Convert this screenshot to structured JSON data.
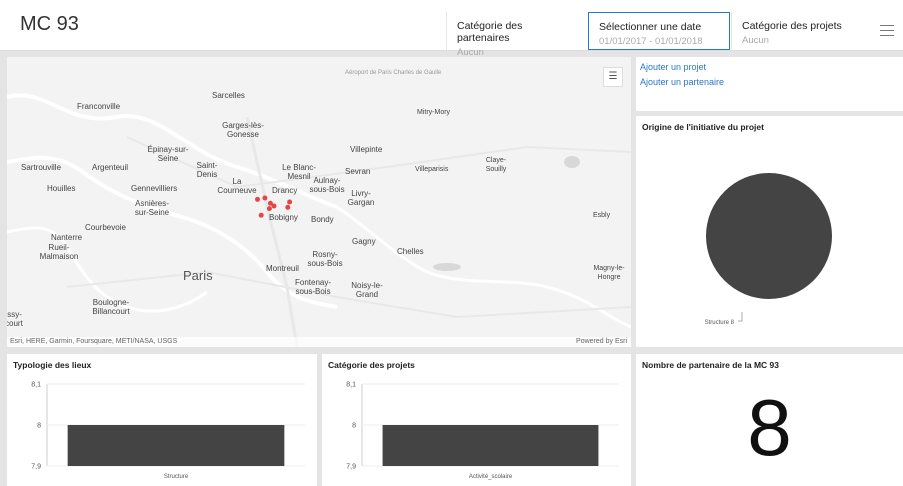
{
  "header": {
    "title": "MC 93",
    "filters": [
      {
        "label": "Catégorie des partenaires",
        "value": "Aucun"
      },
      {
        "label": "Sélectionner une date",
        "value": "01/01/2017 - 01/01/2018"
      },
      {
        "label": "Catégorie des projets",
        "value": "Aucun"
      }
    ]
  },
  "map": {
    "attribution": "Esri, HERE, Garmin, Foursquare, METI/NASA, USGS",
    "powered_by": "Powered by Esri",
    "legend_icon": "list-icon",
    "labels": [
      "Sarcelles",
      "Franconville",
      "Garges-lès-Gonesse",
      "Mitry-Mory",
      "Villepinte",
      "Épinay-sur-Seine",
      "Sartrouville",
      "Argenteuil",
      "Saint-Denis",
      "Le Blanc-Mesnil",
      "Sevran",
      "Villeparisis",
      "Claye-Souilly",
      "Houilles",
      "La Courneuve",
      "Drancy",
      "Aulnay-sous-Bois",
      "Gennevilliers",
      "Livry-Gargan",
      "Asnières-sur-Seine",
      "Bobigny",
      "Bondy",
      "Esbly",
      "Courbevoie",
      "Nanterre",
      "Gagny",
      "Rueil-Malmaison",
      "Chelles",
      "Rosny-sous-Bois",
      "Montreuil",
      "Paris",
      "Magny-le-Hongre",
      "Fontenay-sous-Bois",
      "Noisy-le-Grand",
      "Boulogne-Billancourt",
      "Aéroport de Paris Charles de Gaulle",
      "Issy-",
      "court"
    ],
    "points": [
      {
        "lon": 2.433,
        "lat": 48.912
      },
      {
        "lon": 2.441,
        "lat": 48.913
      },
      {
        "lon": 2.447,
        "lat": 48.909
      },
      {
        "lon": 2.451,
        "lat": 48.907
      },
      {
        "lon": 2.446,
        "lat": 48.905
      },
      {
        "lon": 2.468,
        "lat": 48.91
      },
      {
        "lon": 2.466,
        "lat": 48.906
      },
      {
        "lon": 2.437,
        "lat": 48.9
      }
    ],
    "point_color": "#e04848"
  },
  "links": {
    "add_project": "Ajouter un projet",
    "add_partner": "Ajouter un partenaire"
  },
  "pie": {
    "title": "Origine de l'initiative du projet",
    "slice_label": "Structure 8"
  },
  "bar1": {
    "title": "Typologie des lieux"
  },
  "bar2": {
    "title": "Catégorie des projets"
  },
  "number": {
    "title": "Nombre de partenaire de la MC 93",
    "value": "8"
  },
  "chart_data": [
    {
      "type": "pie",
      "title": "Origine de l'initiative du projet",
      "categories": [
        "Structure"
      ],
      "values": [
        8
      ],
      "color": "#444444"
    },
    {
      "type": "bar",
      "title": "Typologie des lieux",
      "categories": [
        "Structure"
      ],
      "values": [
        8
      ],
      "yticks": [
        "8,1",
        "8",
        "7,9"
      ],
      "ylim": [
        7.9,
        8.1
      ],
      "color": "#444444"
    },
    {
      "type": "bar",
      "title": "Catégorie des projets",
      "categories": [
        "Activité_scolaire"
      ],
      "values": [
        8
      ],
      "yticks": [
        "8,1",
        "8",
        "7,9"
      ],
      "ylim": [
        7.9,
        8.1
      ],
      "color": "#444444"
    }
  ]
}
